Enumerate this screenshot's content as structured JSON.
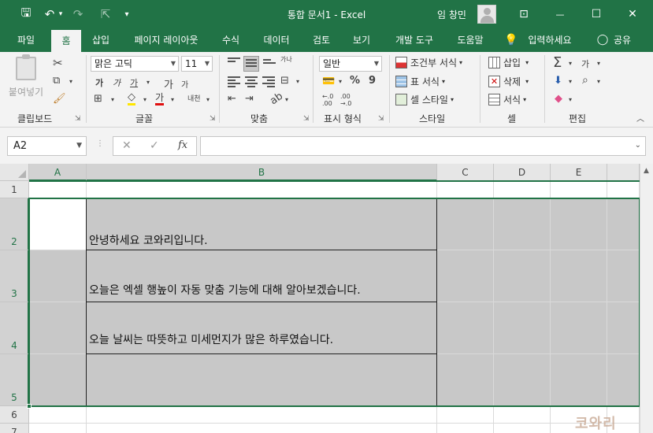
{
  "titlebar": {
    "title": "통합 문서1  -  Excel",
    "user": "임 창민",
    "undo_glyph": "↶",
    "redo_glyph": "↷",
    "save_glyph": "🖫",
    "touch_glyph": "⇱",
    "qa_more": "▾",
    "ribbon_display_glyph": "⊡",
    "minimize_glyph": "—",
    "maximize_glyph": "☐",
    "close_glyph": "✕"
  },
  "tabs": [
    "파일",
    "홈",
    "삽입",
    "페이지 레이아웃",
    "수식",
    "데이터",
    "검토",
    "보기",
    "개발 도구",
    "도움말"
  ],
  "tell_me": "입력하세요",
  "share": "공유",
  "ribbon": {
    "clipboard": {
      "label": "클립보드",
      "paste": "붙여넣기"
    },
    "font": {
      "label": "글꼴",
      "name": "맑은 고딕",
      "size": "11",
      "bold": "가",
      "italic": "가",
      "underline": "가",
      "grow": "가",
      "shrink": "가",
      "font_color": "가",
      "phonetic": "내천"
    },
    "align": {
      "label": "맞춤",
      "wrap": "가나"
    },
    "number": {
      "label": "표시 형식",
      "format": "일반",
      "percent": "%",
      "comma": "9",
      "inc_dec": "←.0\n.00",
      "dec_dec": ".00\n→.0"
    },
    "styles": {
      "label": "스타일",
      "conditional": "조건부 서식",
      "table": "표 서식",
      "cell": "셀 스타일"
    },
    "cells": {
      "label": "셀",
      "insert": "삽입",
      "delete": "삭제",
      "format": "서식"
    },
    "edit": {
      "label": "편집",
      "sum": "Σ",
      "sort": "가",
      "find": "⌕"
    }
  },
  "formula_bar": {
    "name_box": "A2",
    "cancel": "✕",
    "enter": "✓",
    "fx": "fx",
    "value": ""
  },
  "columns": [
    "A",
    "B",
    "C",
    "D",
    "E"
  ],
  "rows": [
    "1",
    "2",
    "3",
    "4",
    "5",
    "6",
    "7"
  ],
  "cell_b2": {
    "line1": "안녕하세요 코와리입니다.",
    "line2": "오늘은 엑셀 행높이 자동 맞춤 기능에 대해 알아보겠습니다.",
    "line3": "오늘 날씨는 따뜻하고 미세먼지가 많은 하루였습니다."
  },
  "watermark": "코와리",
  "colors": {
    "accent": "#217346",
    "ribbon_bg": "#f3f3f3",
    "selection_shade": "#c8c8c8"
  }
}
